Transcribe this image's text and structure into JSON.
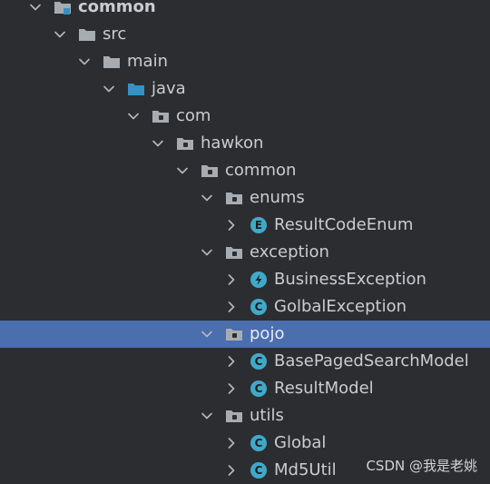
{
  "colors": {
    "background": "#2b2d30",
    "selection": "#4b6eaf",
    "text": "#c9ccd1",
    "folder": "#a7acb2",
    "source_folder": "#3592c4",
    "class_icon": "#40a9c9",
    "exception_icon": "#40a9c9"
  },
  "tree": {
    "rows": [
      {
        "label": "common",
        "icon": "module-folder-icon",
        "expanded": true,
        "bold": true
      },
      {
        "label": "src",
        "icon": "folder-icon",
        "expanded": true
      },
      {
        "label": "main",
        "icon": "folder-icon",
        "expanded": true
      },
      {
        "label": "java",
        "icon": "source-root-folder-icon",
        "expanded": true
      },
      {
        "label": "com",
        "icon": "package-icon",
        "expanded": true
      },
      {
        "label": "hawkon",
        "icon": "package-icon",
        "expanded": true
      },
      {
        "label": "common",
        "icon": "package-icon",
        "expanded": true
      },
      {
        "label": "enums",
        "icon": "package-icon",
        "expanded": true
      },
      {
        "label": "ResultCodeEnum",
        "icon": "enum-icon",
        "expanded": false,
        "badge": "E"
      },
      {
        "label": "exception",
        "icon": "package-icon",
        "expanded": true
      },
      {
        "label": "BusinessException",
        "icon": "exception-class-icon",
        "expanded": false
      },
      {
        "label": "GolbalException",
        "icon": "class-icon",
        "expanded": false,
        "badge": "C"
      },
      {
        "label": "pojo",
        "icon": "package-icon",
        "expanded": true,
        "selected": true
      },
      {
        "label": "BasePagedSearchModel",
        "icon": "class-icon",
        "expanded": false,
        "badge": "C"
      },
      {
        "label": "ResultModel",
        "icon": "class-icon",
        "expanded": false,
        "badge": "C"
      },
      {
        "label": "utils",
        "icon": "package-icon",
        "expanded": true
      },
      {
        "label": "Global",
        "icon": "class-icon",
        "expanded": false,
        "badge": "C"
      },
      {
        "label": "Md5Util",
        "icon": "class-icon",
        "expanded": false,
        "badge": "C"
      }
    ]
  },
  "watermark": "CSDN @我是老姚"
}
